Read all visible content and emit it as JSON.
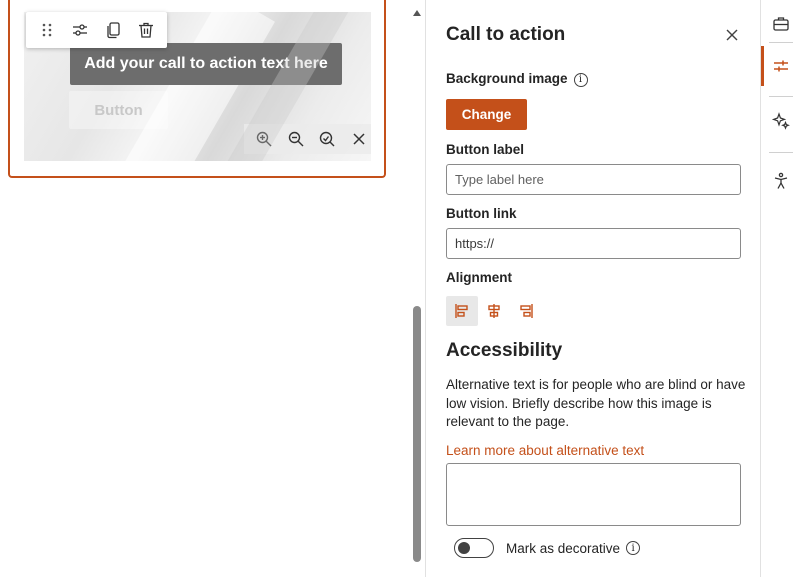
{
  "webpart": {
    "cta_text": "Add your call to action text here",
    "cta_button": "Button"
  },
  "toolbar": {
    "icons": [
      "drag-handle-icon",
      "edit-properties-icon",
      "duplicate-icon",
      "delete-icon"
    ]
  },
  "zoom_bar": {
    "icons": [
      "zoom-in-icon",
      "zoom-out-icon",
      "reset-zoom-icon",
      "close-icon"
    ]
  },
  "pane": {
    "title": "Call to action",
    "background_image_label": "Background image",
    "change_label": "Change",
    "button_label_label": "Button label",
    "button_label_placeholder": "Type label here",
    "button_link_label": "Button link",
    "button_link_value": "https://",
    "alignment_label": "Alignment",
    "alignment_selected": "left",
    "accessibility_title": "Accessibility",
    "accessibility_desc": "Alternative text is for people who are blind or have low vision. Briefly describe how this image is relevant to the page.",
    "learn_more": "Learn more about alternative text",
    "decorative_label": "Mark as decorative",
    "decorative_on": false,
    "info_glyph": "i"
  },
  "rail": {
    "icons": [
      "toolbox-icon",
      "properties-icon",
      "design-ideas-icon",
      "accessibility-icon"
    ],
    "active": "properties-icon"
  },
  "colors": {
    "accent": "#c4501a",
    "text": "#242424",
    "border": "#8a8a8a"
  }
}
